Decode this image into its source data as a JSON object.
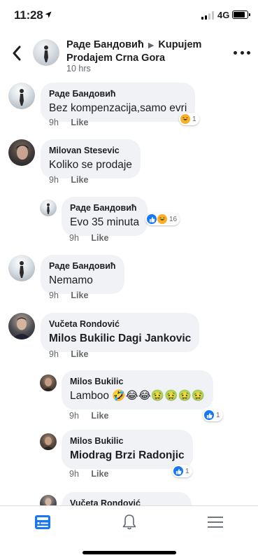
{
  "status_bar": {
    "time": "11:28",
    "network": "4G",
    "battery_level": 0.9
  },
  "header": {
    "author": "Раде Бандовић",
    "group": "Kupujem Prodajem Crna Gora",
    "time": "10 hrs"
  },
  "colors": {
    "like_blue": "#1877f2",
    "bubble_bg": "#f0f2f5",
    "meta_gray": "#65676b"
  },
  "comments": [
    {
      "author": "Раде Бандовић",
      "text": "Bez kompenzacija,samo evri",
      "time": "9h",
      "like_label": "Like",
      "reactions": [
        "haha"
      ],
      "reaction_count": "1"
    },
    {
      "author": "Milovan Stesevic",
      "text": "Koliko se prodaje",
      "time": "9h",
      "like_label": "Like"
    },
    {
      "author": "Раде Бандовић",
      "text": "Evo 35 minuta",
      "time": "9h",
      "like_label": "Like",
      "reactions": [
        "like",
        "haha"
      ],
      "reaction_count": "16"
    },
    {
      "author": "Раде Бандовић",
      "text": "Nemamo",
      "time": "9h",
      "like_label": "Like"
    },
    {
      "author": "Vučeta Rondović",
      "text": "Milos Bukilic Dagi Jankovic",
      "time": "9h",
      "like_label": "Like"
    },
    {
      "author": "Milos Bukilic",
      "text": "Lamboo 🤣😂😂🤢🤢🤢🤢",
      "time": "9h",
      "like_label": "Like",
      "reactions": [
        "like"
      ],
      "reaction_count": "1"
    },
    {
      "author": "Milos Bukilic",
      "text": "Miodrag Brzi Radonjic",
      "time": "9h",
      "like_label": "Like",
      "reactions": [
        "like"
      ],
      "reaction_count": "1"
    },
    {
      "author": "Vučeta Rondović"
    }
  ],
  "nav": {
    "icons": [
      "feed-icon",
      "bell-icon",
      "menu-icon"
    ]
  }
}
